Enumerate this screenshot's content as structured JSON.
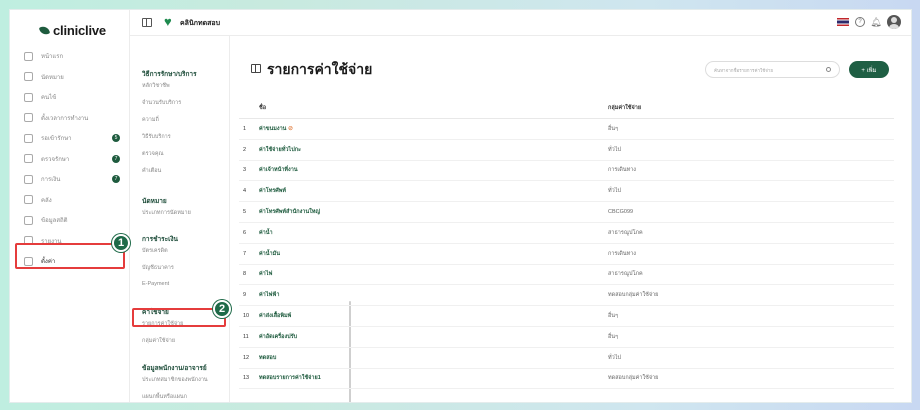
{
  "app": {
    "logo": "cliniclive",
    "clinic_name": "คลินิกทดสอบ"
  },
  "sidebar": {
    "items": [
      {
        "label": "หน้าแรก",
        "icon": "home-icon"
      },
      {
        "label": "นัดหมาย",
        "icon": "calendar-icon"
      },
      {
        "label": "คนไข้",
        "icon": "user-icon"
      },
      {
        "label": "ตั้งเวลาการทำงาน",
        "icon": "clock-icon"
      },
      {
        "label": "รอเข้ารักษา",
        "icon": "queue-icon",
        "badge": "5"
      },
      {
        "label": "ตรวจรักษา",
        "icon": "stethoscope-icon",
        "badge": "7"
      },
      {
        "label": "การเงิน",
        "icon": "money-icon",
        "badge": "7"
      },
      {
        "label": "คลัง",
        "icon": "box-icon"
      },
      {
        "label": "ข้อมูลสถิติ",
        "icon": "database-icon"
      },
      {
        "label": "รายงาน",
        "icon": "report-icon"
      },
      {
        "label": "ตั้งค่า",
        "icon": "gear-icon"
      }
    ]
  },
  "markers": [
    "1",
    "2"
  ],
  "submenu": {
    "sections": [
      {
        "title": "วิธีการรักษา/บริการ",
        "items": [
          "หลักวิชาชีพ",
          "จำนวนรับบริการ",
          "ความถี่",
          "วิธีรับบริการ",
          "ตรวจคุณ",
          "คำเตือน"
        ]
      },
      {
        "title": "นัดหมาย",
        "items": [
          "ประเภทการนัดหมาย"
        ]
      },
      {
        "title": "การชำระเงิน",
        "items": [
          "บัตรเครดิต",
          "บัญชีธนาคาร",
          "E-Payment"
        ]
      },
      {
        "title": "ค่าใช้จ่าย",
        "items": [
          "รายการค่าใช้จ่าย",
          "กลุ่มค่าใช้จ่าย"
        ]
      },
      {
        "title": "ข้อมูลพนักงาน/อาจารย์",
        "items": [
          "ประเภทสมาชิกของพนักงาน",
          "แผนกพื้นหรือแผนก"
        ]
      }
    ]
  },
  "main": {
    "title": "รายการค่าใช้จ่าย",
    "search_placeholder": "ค้นหาจากชื่อรายการค่าใช้จ่าย",
    "add_label": "+ เพิ่ม",
    "columns": [
      "ชื่อ",
      "กลุ่มค่าใช้จ่าย"
    ],
    "rows": [
      {
        "n": "1",
        "name": "ค่าขนมงาน",
        "group": "อื่นๆ",
        "warn": true
      },
      {
        "n": "2",
        "name": "ค่าใช้จ่ายทั่วไปกะ",
        "group": "ทั่วไป"
      },
      {
        "n": "3",
        "name": "ค่าเจ้าหน้าที่งาน",
        "group": "การเดินทาง"
      },
      {
        "n": "4",
        "name": "ค่าโทรศัพท์",
        "group": "ทั่วไป"
      },
      {
        "n": "5",
        "name": "ค่าโทรศัพท์สำนักงานใหญ่",
        "group": "CBCG099"
      },
      {
        "n": "6",
        "name": "ค่าน้ำ",
        "group": "สาธารณูปโภค"
      },
      {
        "n": "7",
        "name": "ค่าน้ำมัน",
        "group": "การเดินทาง"
      },
      {
        "n": "8",
        "name": "ค่าไฟ",
        "group": "สาธารณูปโภค"
      },
      {
        "n": "9",
        "name": "ค่าไฟฟ้า",
        "group": "ทดสอบกลุ่มค่าใช้จ่าย"
      },
      {
        "n": "10",
        "name": "ค่าส่งเสื้อพิมพ์",
        "group": "อื่นๆ"
      },
      {
        "n": "11",
        "name": "ค่าอัดเครื่องปรับ",
        "group": "อื่นๆ"
      },
      {
        "n": "12",
        "name": "ทดสอบ",
        "group": "ทั่วไป"
      },
      {
        "n": "13",
        "name": "ทดสอบรายการค่าใช้จ่าย1",
        "group": "ทดสอบกลุ่มค่าใช้จ่าย"
      }
    ]
  }
}
